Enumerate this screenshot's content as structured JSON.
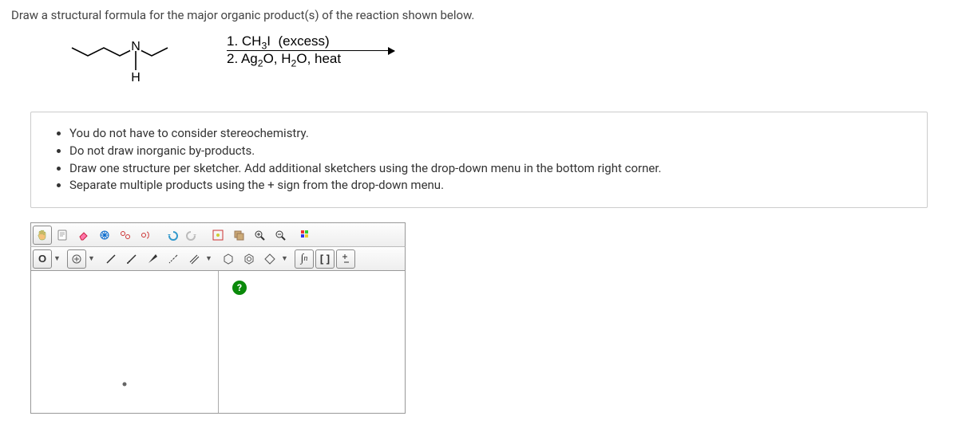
{
  "question": "Draw a structural formula for the major organic product(s) of the reaction shown below.",
  "reaction": {
    "reagent1": "1. CH3I  (excess)",
    "reagent2": "2. Ag2O, H2O, heat"
  },
  "instructions": [
    "You do not have to consider stereochemistry.",
    "Do not draw inorganic by-products.",
    "Draw one structure per sketcher. Add additional sketchers using the drop-down menu in the bottom right corner.",
    "Separate multiple products using the + sign from the drop-down menu."
  ],
  "toolbar_row1": {
    "hand": "hand-icon",
    "select": "select-icon",
    "erase": "erase-icon",
    "move": "move-icon",
    "lasso_pair": "lasso-pair-icon",
    "lasso_cut": "lasso-cut-icon",
    "undo": "undo-icon",
    "redo": "redo-icon",
    "center": "center-icon",
    "copy": "copy-icon",
    "zoom_in": "zoom-in-icon",
    "zoom_out": "zoom-out-icon",
    "color": "color-icon"
  },
  "toolbar_row2": {
    "element_o": "O",
    "add_tool": "add-icon",
    "bond_single": "bond-single",
    "bond_sprout": "bond-sprout",
    "bond_up": "wedge-up",
    "bond_down": "wedge-down",
    "bond_multi": "multi-bond",
    "ring1": "ring-icon",
    "ring2": "ring-arom-icon",
    "ring3": "ring-hex-icon",
    "script_n": "ₙ",
    "bracket": "[ ]",
    "charge": "charge-icon"
  },
  "help": "?"
}
